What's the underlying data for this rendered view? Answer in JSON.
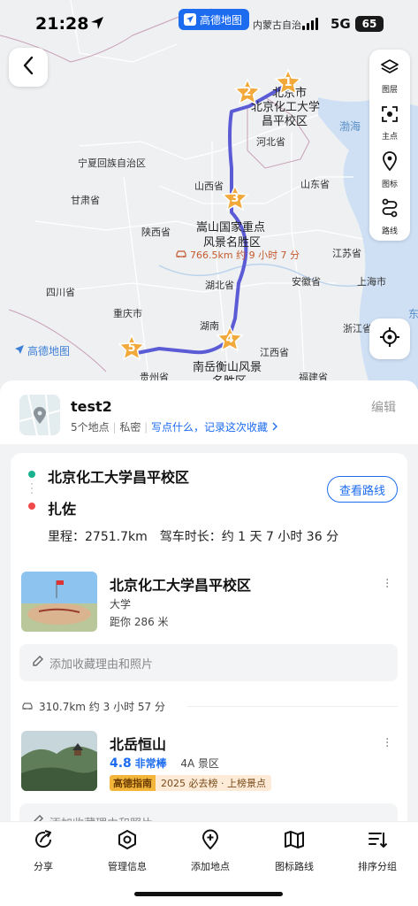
{
  "status": {
    "time": "21:28",
    "app_pill": "高德地图",
    "region": "内蒙古自治",
    "network": "5G",
    "battery": "65"
  },
  "map": {
    "labels": {
      "ningxia": "宁夏回族自治区",
      "gansu": "甘肃省",
      "shanxi": "山西省",
      "hebei": "河北省",
      "shandong": "山东省",
      "shaanxi": "陕西省",
      "henan_poi": "嵩山国家重点",
      "henan_poi2": "风景名胜区",
      "jiangsu": "江苏省",
      "anhui": "安徽省",
      "hubei": "湖北省",
      "shanghai": "上海市",
      "sichuan": "四川省",
      "chongqing": "重庆市",
      "zhejiang": "浙江省",
      "hunan": "湖南",
      "jiangxi": "江西省",
      "guizhou": "贵州省",
      "fujian": "福建省",
      "hengshan": "南岳衡山风景",
      "hengshan2": "名胜区",
      "beijing": "北京市",
      "buct1": "北京化工大学",
      "buct2": "昌平校区",
      "bohai": "渤海",
      "east": "东"
    },
    "route_badge": "766.5km 约 9 小时 7 分",
    "logo": "高德地图",
    "pins": [
      "1",
      "2",
      "3",
      "4",
      "5"
    ]
  },
  "tools": [
    {
      "label": "图层",
      "icon": "layers-icon"
    },
    {
      "label": "主点",
      "icon": "focus-icon"
    },
    {
      "label": "图标",
      "icon": "pin-icon"
    },
    {
      "label": "路线",
      "icon": "route-icon"
    }
  ],
  "header": {
    "name": "test2",
    "count": "5个地点",
    "privacy": "私密",
    "prompt": "写点什么，记录这次收藏",
    "edit": "编辑"
  },
  "route": {
    "from": "北京化工大学昌平校区",
    "to": "扎佐",
    "view_button": "查看路线",
    "distance": "里程：2751.7km",
    "duration": "驾车时长：约 1 天 7 小时 36 分"
  },
  "pois": [
    {
      "title": "北京化工大学昌平校区",
      "category": "大学",
      "distance": "距你 286 米",
      "add_note": "添加收藏理由和照片"
    },
    {
      "segment": "310.7km 约 3 小时 57 分",
      "title": "北岳恒山",
      "rating": "4.8",
      "rating_text": "非常棒",
      "level": "4A 景区",
      "guide_brand": "高德指南",
      "guide_text": "2025 必去榜 · 上榜景点",
      "add_note": "添加收藏理由和照片"
    }
  ],
  "tabbar": [
    {
      "label": "分享",
      "icon": "share-icon"
    },
    {
      "label": "管理信息",
      "icon": "manage-icon"
    },
    {
      "label": "添加地点",
      "icon": "add-place-icon"
    },
    {
      "label": "图标路线",
      "icon": "map-route-icon"
    },
    {
      "label": "排序分组",
      "icon": "sort-icon"
    }
  ],
  "colors": {
    "accent": "#1d6cf0",
    "route": "#5b5bd6",
    "pin": "#f2a93b",
    "start_dot": "#1bb38f",
    "end_dot": "#f04a4a"
  }
}
